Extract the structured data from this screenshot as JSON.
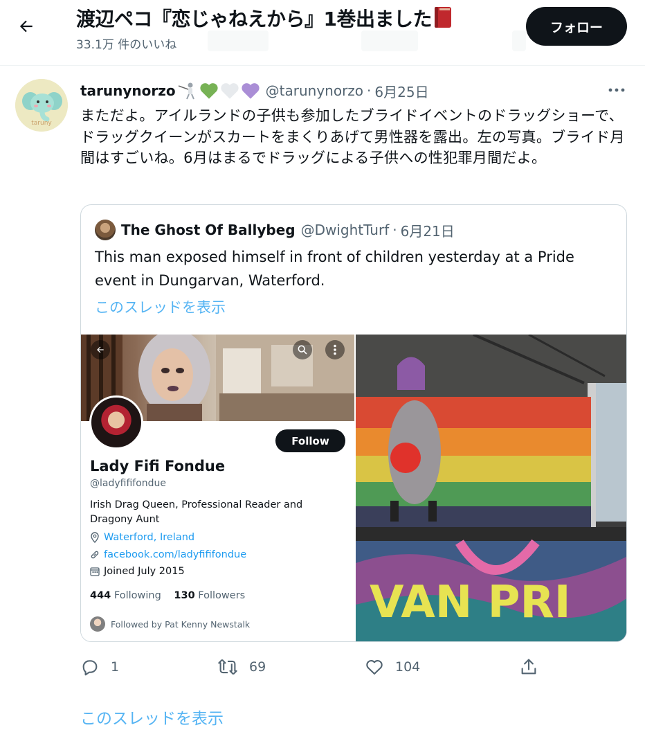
{
  "header": {
    "title": "渡辺ペコ『恋じゃねえから』1巻出ました",
    "subtitle": "33.1万 件のいいね",
    "follow_label": "フォロー"
  },
  "tweet": {
    "author_name": "tarunynorzo",
    "avatar_text": "taruny",
    "handle": "@tarunynorzo",
    "dot": "·",
    "date": "6月25日",
    "text": "まただよ。アイルランドの子供も参加したブライドイベントのドラッグショーで、ドラッグクイーンがスカートをまくりあげて男性器を露出。左の写真。ブライド月間はすごいね。6月はまるでドラッグによる子供への性犯罪月間だよ。"
  },
  "quote": {
    "author_name": "The Ghost Of Ballybeg",
    "handle": "@DwightTurf",
    "dot": "·",
    "date": "6月21日",
    "text": "This man exposed himself in front of children yesterday at a Pride event in Dungarvan, Waterford.",
    "show_thread": "このスレッドを表示"
  },
  "profile_shot": {
    "follow_label": "Follow",
    "name": "Lady Fifi Fondue",
    "handle": "@ladyfififondue",
    "bio": "Irish Drag Queen, Professional Reader and Dragony Aunt",
    "location": "Waterford, Ireland",
    "website": "facebook.com/ladyfififondue",
    "joined": "Joined July 2015",
    "following_count": "444",
    "following_label": "Following",
    "followers_count": "130",
    "followers_label": "Followers",
    "followed_by": "Followed by Pat Kenny Newstalk"
  },
  "stage_photo": {
    "banner_text": "VAN PRI"
  },
  "actions": {
    "reply_count": "1",
    "retweet_count": "69",
    "like_count": "104"
  },
  "footer": {
    "show_thread": "このスレッドを表示"
  },
  "colors": {
    "accent": "#1d9bf0",
    "text": "#0f1419",
    "secondary": "#536471",
    "follow_button": "#0f1419",
    "border": "#cfd9de"
  }
}
